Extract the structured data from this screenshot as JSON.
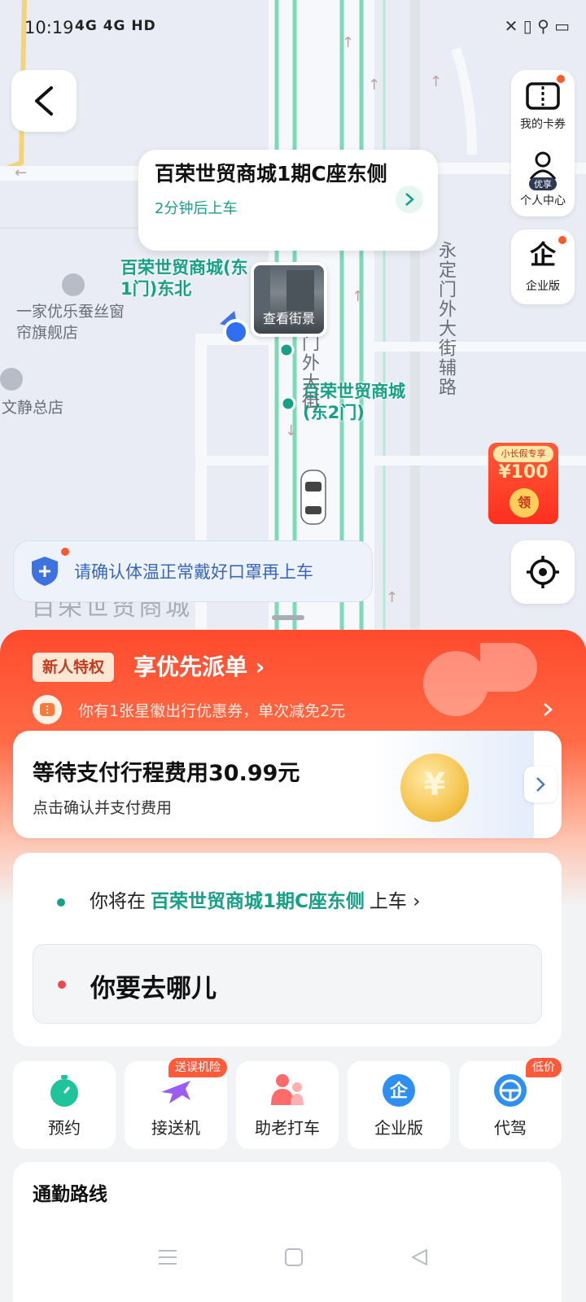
{
  "status_bar": {
    "time": "10:19",
    "signal": "4G 4G HD",
    "right_icons": "✕ ▯ ⚲ ▭"
  },
  "map": {
    "pickup_card": {
      "name": "百荣世贸商城1期C座东侧",
      "eta": "2分钟后上车"
    },
    "street_view_label": "查看街景",
    "labels": {
      "poi1": "百荣世贸商城(东1门)东北",
      "shop1": "一家优乐蚕丝窗帘旗舰店",
      "shop2": "文静总店",
      "station2": "百荣世贸商城(东2门)",
      "road_main": "门外大街",
      "road_side": "永定门外大街辅路",
      "area": "百荣世贸商城"
    },
    "side": {
      "card_label": "我的卡券",
      "profile_label": "个人中心",
      "profile_badge": "优享",
      "enterprise_label": "企业版"
    },
    "coupon_float": {
      "tag": "小长假专享",
      "amount": "¥100",
      "get": "领"
    },
    "safety_notice": "请确认体温正常戴好口罩再上车"
  },
  "promo": {
    "badge": "新人特权",
    "title": "享优先派单 ›",
    "coupon_text": "你有1张星徽出行优惠券，单次减免2元"
  },
  "payment": {
    "title": "等待支付行程费用30.99元",
    "subtitle": "点击确认并支付费用",
    "coin_symbol": "¥"
  },
  "trip": {
    "prefix": "你将在",
    "location": "百荣世贸商城1期C座东侧",
    "suffix": "上车 ›",
    "destination_placeholder": "你要去哪儿"
  },
  "services": [
    {
      "label": "预约",
      "tag": ""
    },
    {
      "label": "接送机",
      "tag": "送误机险"
    },
    {
      "label": "助老打车",
      "tag": ""
    },
    {
      "label": "企业版",
      "tag": ""
    },
    {
      "label": "代驾",
      "tag": "低价"
    }
  ],
  "commute": {
    "title": "通勤路线"
  },
  "colors": {
    "brand_green": "#16a085",
    "promo_red": "#ff4a2e",
    "notice_blue": "#3a68b8"
  }
}
